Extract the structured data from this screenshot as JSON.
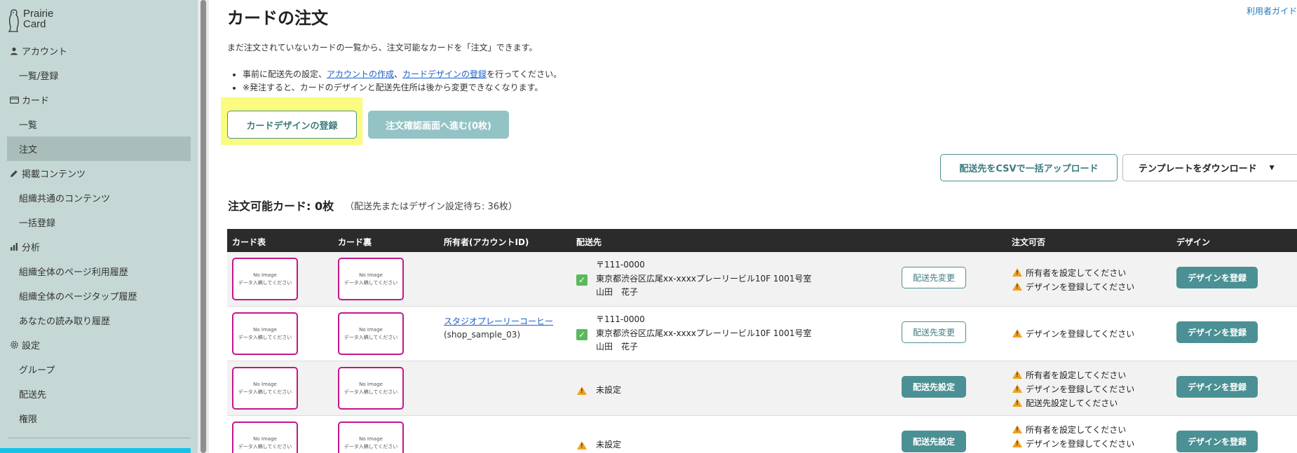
{
  "brand": {
    "line1": "Prairie",
    "line2": "Card"
  },
  "sidebar": {
    "sections": [
      {
        "label": "アカウント",
        "icon": "user-icon",
        "items": [
          {
            "label": "一覧/登録"
          }
        ]
      },
      {
        "label": "カード",
        "icon": "card-icon",
        "items": [
          {
            "label": "一覧"
          },
          {
            "label": "注文",
            "active": true
          }
        ]
      },
      {
        "label": "掲載コンテンツ",
        "icon": "pencil-icon",
        "items": [
          {
            "label": "組織共通のコンテンツ"
          },
          {
            "label": "一括登録"
          }
        ]
      },
      {
        "label": "分析",
        "icon": "bar-chart-icon",
        "items": [
          {
            "label": "組織全体のページ利用履歴"
          },
          {
            "label": "組織全体のページタップ履歴"
          },
          {
            "label": "あなたの読み取り履歴"
          }
        ]
      },
      {
        "label": "設定",
        "icon": "gear-icon",
        "items": [
          {
            "label": "グループ"
          },
          {
            "label": "配送先"
          },
          {
            "label": "権限"
          }
        ]
      }
    ]
  },
  "header": {
    "title": "カードの注文",
    "guide_link": "利用者ガイド"
  },
  "intro": "まだ注文されていないカードの一覧から、注文可能なカードを「注文」できます。",
  "notes": {
    "line1_prefix": "事前に配送先の設定、",
    "line1_link1": "アカウントの作成",
    "line1_sep": "、",
    "line1_link2": "カードデザインの登録",
    "line1_suffix": "を行ってください。",
    "line2": "※発注すると、カードのデザインと配送先住所は後から変更できなくなります。"
  },
  "actions": {
    "register_design": "カードデザインの登録",
    "confirm_order": "注文確認画面へ進む(0枚)",
    "csv_upload": "配送先をCSVで一括アップロード",
    "template_download": "テンプレートをダウンロード"
  },
  "summary": {
    "title": "注文可能カード: 0枚",
    "sub": "（配送先またはデザイン設定待ち: 36枚）"
  },
  "table": {
    "headers": {
      "front": "カード表",
      "back": "カード裏",
      "owner": "所有者(アカウントID)",
      "ship": "配送先",
      "status": "注文可否",
      "design": "デザイン"
    },
    "no_image": {
      "title": "No Image",
      "sub": "データ入稿してください"
    },
    "rows": [
      {
        "owner_name": "",
        "owner_id": "",
        "ship_set": true,
        "postal": "〒111-0000",
        "address": "東京都渋谷区広尾xx-xxxxプレーリービル10F 1001号室",
        "recipient": "山田　花子",
        "ship_button": "配送先変更",
        "statuses": [
          "所有者を設定してください",
          "デザインを登録してください"
        ],
        "design_button": "デザインを登録"
      },
      {
        "owner_name": "スタジオプレーリーコーヒー",
        "owner_id": "(shop_sample_03)",
        "ship_set": true,
        "postal": "〒111-0000",
        "address": "東京都渋谷区広尾xx-xxxxプレーリービル10F 1001号室",
        "recipient": "山田　花子",
        "ship_button": "配送先変更",
        "statuses": [
          "デザインを登録してください"
        ],
        "design_button": "デザインを登録"
      },
      {
        "owner_name": "",
        "owner_id": "",
        "ship_set": false,
        "unset_label": "未設定",
        "ship_button": "配送先設定",
        "statuses": [
          "所有者を設定してください",
          "デザインを登録してください",
          "配送先設定してください"
        ],
        "design_button": "デザインを登録"
      },
      {
        "owner_name": "",
        "owner_id": "",
        "ship_set": false,
        "unset_label": "未設定",
        "ship_button": "配送先設定",
        "statuses": [
          "所有者を設定してください",
          "デザインを登録してください"
        ],
        "design_button": "デザインを登録"
      }
    ]
  }
}
